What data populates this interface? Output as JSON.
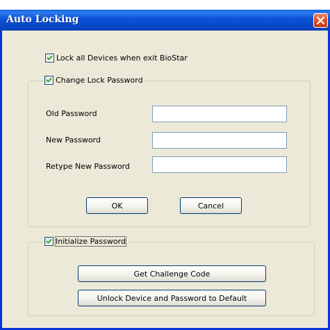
{
  "window": {
    "title": "Auto Locking"
  },
  "lock_all": {
    "label": "Lock all Devices when exit BioStar",
    "checked": true
  },
  "change_password_group": {
    "label": "Change Lock Password",
    "checked": true,
    "fields": [
      {
        "label": "Old Password",
        "value": ""
      },
      {
        "label": "New Password",
        "value": ""
      },
      {
        "label": "Retype New Password",
        "value": ""
      }
    ],
    "ok_label": "OK",
    "cancel_label": "Cancel"
  },
  "initialize_group": {
    "label": "Initialize Password",
    "checked": true,
    "get_challenge_label": "Get Challenge Code",
    "unlock_default_label": "Unlock Device and Password to Default"
  },
  "colors": {
    "title_bar": "#0a52d4",
    "window_bg": "#ece9d8",
    "close_button": "#e0522c",
    "check_mark": "#21a121"
  }
}
